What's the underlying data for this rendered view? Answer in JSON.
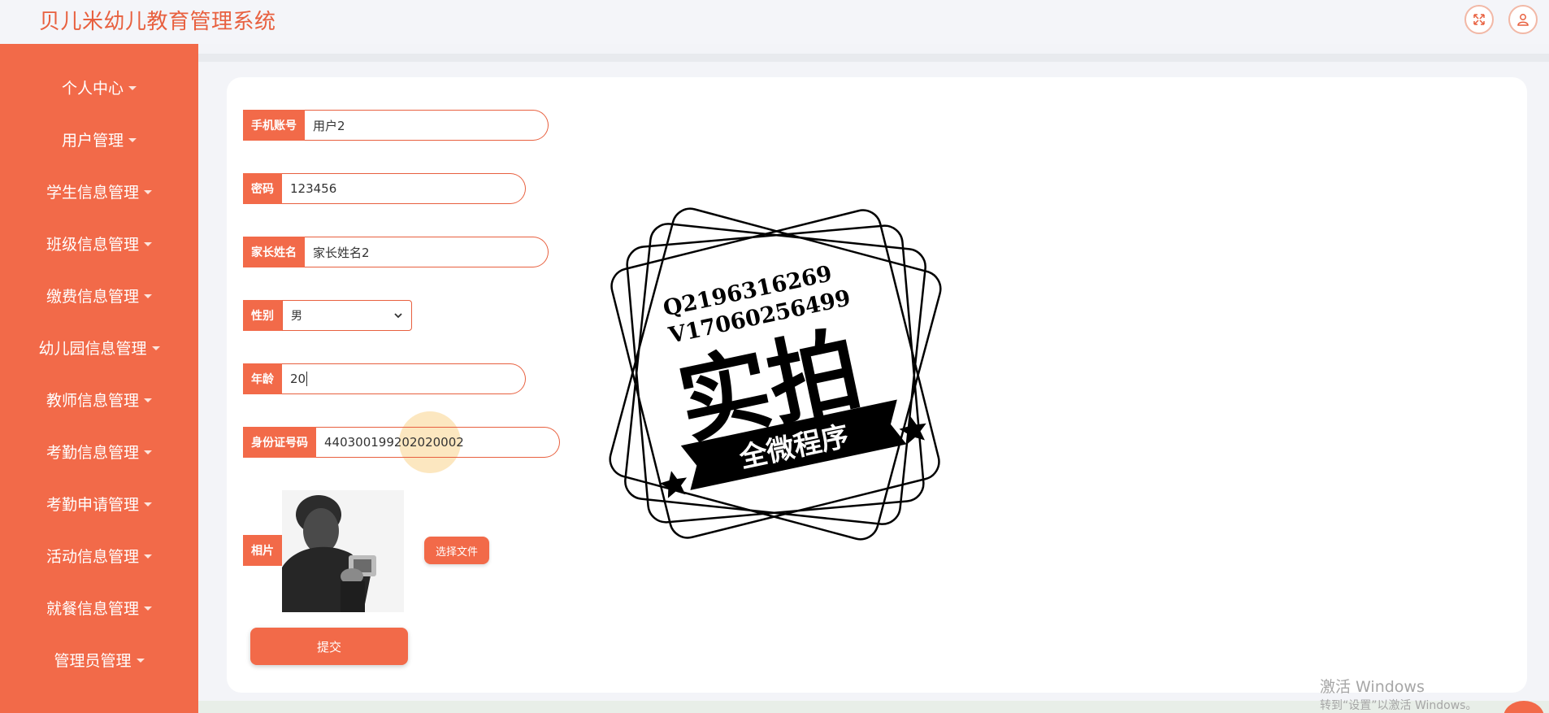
{
  "app": {
    "title": "贝儿米幼儿教育管理系统"
  },
  "topbar": {
    "fullscreen_icon": "expand-arrows-icon",
    "user_icon": "user-icon"
  },
  "sidebar": {
    "items": [
      {
        "label": "个人中心"
      },
      {
        "label": "用户管理"
      },
      {
        "label": "学生信息管理"
      },
      {
        "label": "班级信息管理"
      },
      {
        "label": "缴费信息管理"
      },
      {
        "label": "幼儿园信息管理"
      },
      {
        "label": "教师信息管理"
      },
      {
        "label": "考勤信息管理"
      },
      {
        "label": "考勤申请管理"
      },
      {
        "label": "活动信息管理"
      },
      {
        "label": "就餐信息管理"
      },
      {
        "label": "管理员管理"
      }
    ]
  },
  "form": {
    "phone": {
      "label": "手机账号",
      "value": "用户2"
    },
    "password": {
      "label": "密码",
      "value": "123456"
    },
    "parent_name": {
      "label": "家长姓名",
      "value": "家长姓名2"
    },
    "gender": {
      "label": "性别",
      "value": "男"
    },
    "age": {
      "label": "年龄",
      "value": "20"
    },
    "id_card": {
      "label": "身份证号码",
      "value": "440300199202020002"
    },
    "photo": {
      "label": "相片",
      "choose_file": "选择文件"
    },
    "submit": "提交"
  },
  "watermark": {
    "line1": "Q2196316269",
    "line2": "V17060256499",
    "main": "实拍",
    "banner": "全微程序"
  },
  "windows_activation": {
    "line1": "激活 Windows",
    "line2": "转到“设置”以激活 Windows。"
  },
  "colors": {
    "accent": "#f26a49",
    "title": "#e8603f"
  }
}
